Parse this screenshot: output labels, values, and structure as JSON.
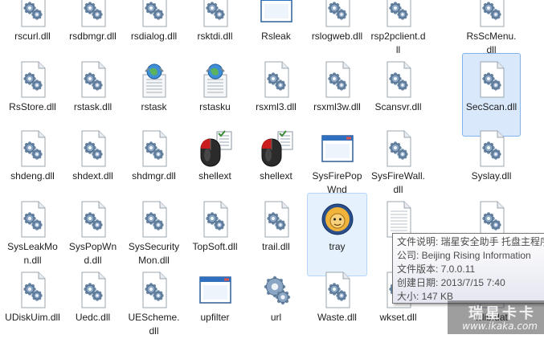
{
  "files": [
    {
      "label": "rscurl.dll",
      "icon": "dll-gear-icon"
    },
    {
      "label": "rsdbmgr.dll",
      "icon": "dll-gear-icon"
    },
    {
      "label": "rsdialog.dll",
      "icon": "dll-gear-icon"
    },
    {
      "label": "rsktdi.dll",
      "icon": "dll-gear-icon"
    },
    {
      "label": "Rsleak",
      "icon": "app-window-icon"
    },
    {
      "label": "rslogweb.dll",
      "icon": "dll-gear-icon"
    },
    {
      "label": "rsp2pclient.dll",
      "icon": "dll-gear-icon"
    },
    {
      "label": "RsScMenu.dll",
      "icon": "dll-gear-icon"
    },
    {
      "label": "RsStore.dll",
      "icon": "dll-gear-icon"
    },
    {
      "label": "rstask.dll",
      "icon": "dll-gear-icon"
    },
    {
      "label": "rstask",
      "icon": "web-document-icon"
    },
    {
      "label": "rstasku",
      "icon": "web-document-icon"
    },
    {
      "label": "rsxml3.dll",
      "icon": "dll-gear-icon"
    },
    {
      "label": "rsxml3w.dll",
      "icon": "dll-gear-icon"
    },
    {
      "label": "Scansvr.dll",
      "icon": "dll-gear-icon"
    },
    {
      "label": "SecScan.dll",
      "icon": "dll-gear-icon"
    },
    {
      "label": "shdeng.dll",
      "icon": "dll-gear-icon"
    },
    {
      "label": "shdext.dll",
      "icon": "dll-gear-icon"
    },
    {
      "label": "shdmgr.dll",
      "icon": "dll-gear-icon"
    },
    {
      "label": "shellext",
      "icon": "mouse-shortcut-icon"
    },
    {
      "label": "shellext",
      "icon": "mouse-shortcut-icon"
    },
    {
      "label": "SysFirePopWnd",
      "icon": "app-window-icon"
    },
    {
      "label": "SysFireWall.dll",
      "icon": "dll-gear-icon"
    },
    {
      "label": "Syslay.dll",
      "icon": "dll-gear-icon"
    },
    {
      "label": "SysLeakMon.dll",
      "icon": "dll-gear-icon"
    },
    {
      "label": "SysPopWnd.dll",
      "icon": "dll-gear-icon"
    },
    {
      "label": "SysSecurityMon.dll",
      "icon": "dll-gear-icon"
    },
    {
      "label": "TopSoft.dll",
      "icon": "dll-gear-icon"
    },
    {
      "label": "trail.dll",
      "icon": "dll-gear-icon"
    },
    {
      "label": "tray",
      "icon": "rising-lion-icon"
    },
    {
      "label": "",
      "icon": "text-file-icon"
    },
    {
      "label": "",
      "icon": "dll-gear-icon"
    },
    {
      "label": "UDiskUim.dll",
      "icon": "dll-gear-icon"
    },
    {
      "label": "Uedc.dll",
      "icon": "dll-gear-icon"
    },
    {
      "label": "UEScheme.dll",
      "icon": "dll-gear-icon"
    },
    {
      "label": "upfilter",
      "icon": "app-window-icon"
    },
    {
      "label": "url",
      "icon": "gear-file-icon"
    },
    {
      "label": "Waste.dll",
      "icon": "dll-gear-icon"
    },
    {
      "label": "wkset.dll",
      "icon": "dll-gear-icon"
    },
    {
      "label": "wlib.dat",
      "icon": "dll-gear-icon"
    }
  ],
  "selected_index": 15,
  "hover_index": 29,
  "tooltip": {
    "line1": "文件说明: 瑞星安全助手 托盘主程序",
    "line2": "公司: Beijing Rising Information",
    "line3": "文件版本: 7.0.0.11",
    "line4": "创建日期: 2013/7/15 7:40",
    "line5": "大小: 147 KB"
  },
  "watermark": {
    "logo": "瑞星卡卡",
    "url": "www.ikaka.com"
  },
  "colors": {
    "selection": "#d9e9fb",
    "selection_border": "#7eb4ea",
    "hover": "#e5f1fc"
  }
}
